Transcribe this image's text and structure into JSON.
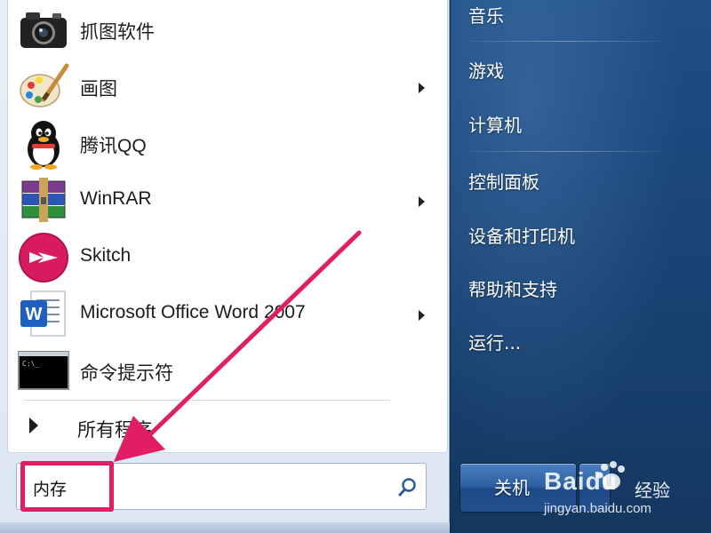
{
  "programs": [
    {
      "label": "抓图软件",
      "icon": "camera-icon",
      "has_submenu": false
    },
    {
      "label": "画图",
      "icon": "paint-palette-icon",
      "has_submenu": true
    },
    {
      "label": "腾讯QQ",
      "icon": "qq-penguin-icon",
      "has_submenu": false
    },
    {
      "label": "WinRAR",
      "icon": "winrar-books-icon",
      "has_submenu": true
    },
    {
      "label": "Skitch",
      "icon": "skitch-icon",
      "has_submenu": false
    },
    {
      "label": "Microsoft Office Word 2007",
      "icon": "word-icon",
      "has_submenu": true
    },
    {
      "label": "命令提示符",
      "icon": "cmd-icon",
      "has_submenu": false
    }
  ],
  "all_programs_label": "所有程序",
  "search": {
    "value": "内存",
    "icon": "search-icon"
  },
  "right_items": [
    {
      "label": "音乐"
    },
    {
      "label": "游戏"
    },
    {
      "label": "计算机"
    },
    {
      "label": "控制面板"
    },
    {
      "label": "设备和打印机"
    },
    {
      "label": "帮助和支持"
    },
    {
      "label": "运行..."
    }
  ],
  "shutdown": {
    "label": "关机"
  },
  "watermark": {
    "brand": "Baidu",
    "sub": "经验",
    "url": "jingyan.baidu.com"
  },
  "colors": {
    "highlight": "#e11d63",
    "right_pane": "#1a4679"
  }
}
